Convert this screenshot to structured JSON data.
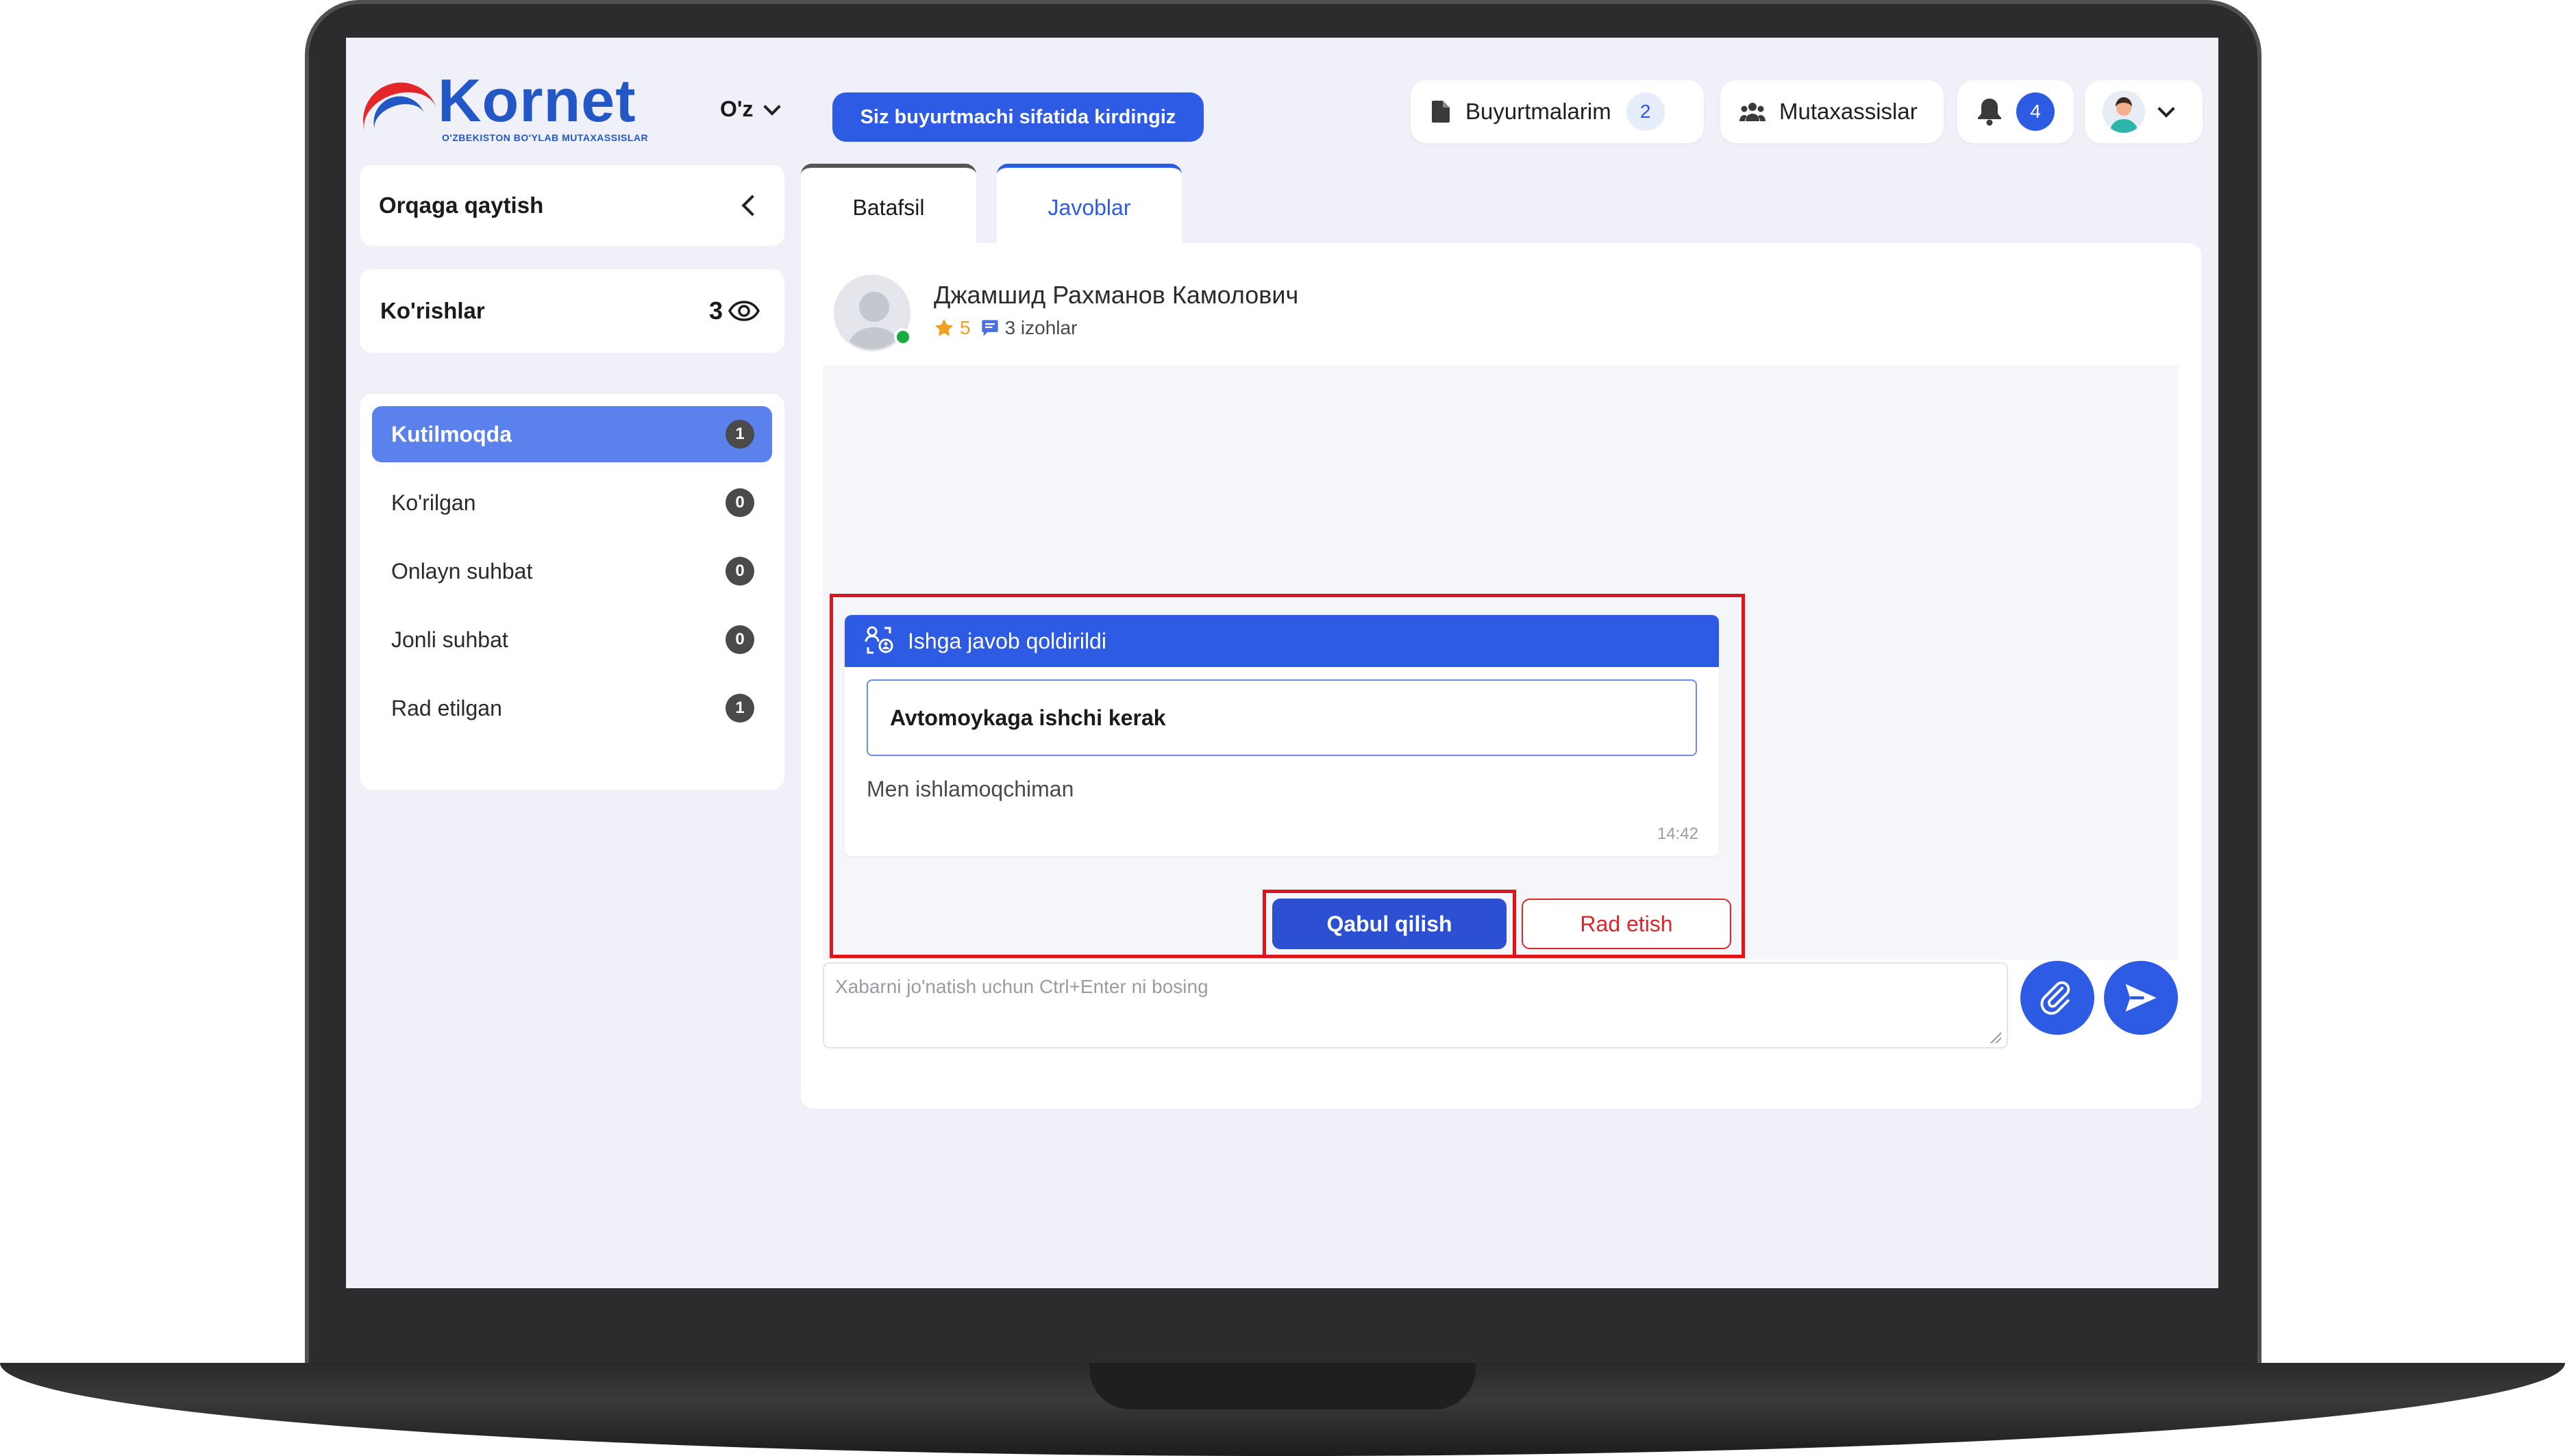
{
  "header": {
    "logo_text": "Kornet",
    "logo_subtitle": "O'ZBEKISTON BO'YLAB MUTAXASSISLAR",
    "language": "O'z",
    "role_notice": "Siz buyurtmachi sifatida kirdingiz",
    "orders_label": "Buyurtmalarim",
    "orders_count": "2",
    "specialists_label": "Mutaxassislar",
    "notifications_count": "4"
  },
  "sidebar": {
    "back_label": "Orqaga qaytish",
    "views_label": "Ko'rishlar",
    "views_count": "3",
    "statuses": [
      {
        "label": "Kutilmoqda",
        "count": "1",
        "active": true
      },
      {
        "label": "Ko'rilgan",
        "count": "0",
        "active": false
      },
      {
        "label": "Onlayn suhbat",
        "count": "0",
        "active": false
      },
      {
        "label": "Jonli suhbat",
        "count": "0",
        "active": false
      },
      {
        "label": "Rad etilgan",
        "count": "1",
        "active": false
      }
    ]
  },
  "tabs": [
    {
      "label": "Batafsil",
      "active": false
    },
    {
      "label": "Javoblar",
      "active": true
    }
  ],
  "respondent": {
    "name": "Джамшид Рахманов Камолович",
    "rating": "5",
    "reviews": "3 izohlar",
    "online": true
  },
  "message": {
    "header": "Ishga javob qoldirildi",
    "job_title": "Avtomoykaga ishchi kerak",
    "text": "Men ishlamoqchiman",
    "time": "14:42"
  },
  "actions": {
    "accept_label": "Qabul qilish",
    "reject_label": "Rad etish"
  },
  "composer": {
    "placeholder": "Xabarni jo'natish uchun Ctrl+Enter ni bosing"
  },
  "colors": {
    "primary": "#2d5be3",
    "active_status": "#5b82ec",
    "danger": "#e1252b",
    "highlight": "#e1141c",
    "rating": "#f0a020",
    "online": "#1bab3e"
  }
}
